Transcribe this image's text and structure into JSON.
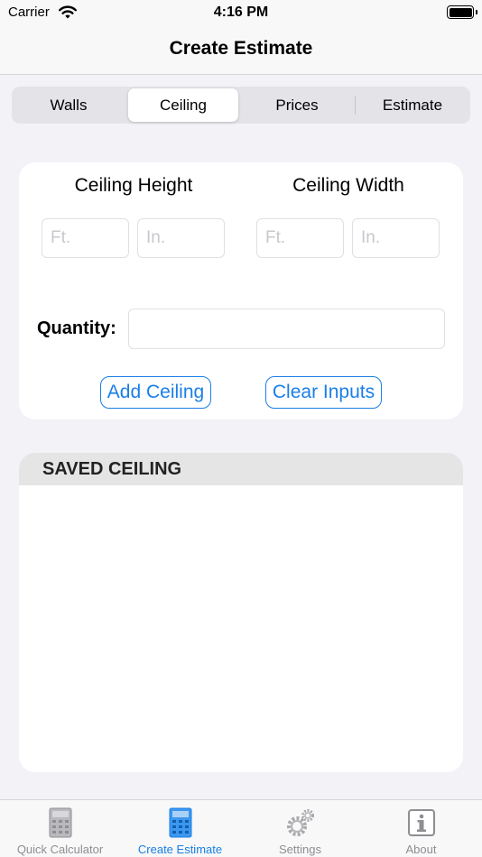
{
  "status": {
    "carrier": "Carrier",
    "time": "4:16 PM",
    "battery_level": 1.0
  },
  "nav": {
    "title": "Create Estimate"
  },
  "segments": [
    {
      "label": "Walls",
      "active": false
    },
    {
      "label": "Ceiling",
      "active": true
    },
    {
      "label": "Prices",
      "active": false
    },
    {
      "label": "Estimate",
      "active": false
    }
  ],
  "form": {
    "height_label": "Ceiling Height",
    "width_label": "Ceiling Width",
    "height_ft_placeholder": "Ft.",
    "height_in_placeholder": "In.",
    "width_ft_placeholder": "Ft.",
    "width_in_placeholder": "In.",
    "quantity_label": "Quantity:",
    "quantity_value": "",
    "add_label": "Add Ceiling",
    "clear_label": "Clear Inputs"
  },
  "saved": {
    "header": "SAVED CEILING",
    "items": []
  },
  "tabs": [
    {
      "label": "Quick Calculator",
      "icon": "calculator-icon",
      "active": false
    },
    {
      "label": "Create Estimate",
      "icon": "calculator-icon",
      "active": true
    },
    {
      "label": "Settings",
      "icon": "gear-icon",
      "active": false
    },
    {
      "label": "About",
      "icon": "info-icon",
      "active": false
    }
  ],
  "colors": {
    "accent": "#1a7fe6",
    "inactive_tab": "#8e8e93",
    "background": "#f2f2f7"
  }
}
